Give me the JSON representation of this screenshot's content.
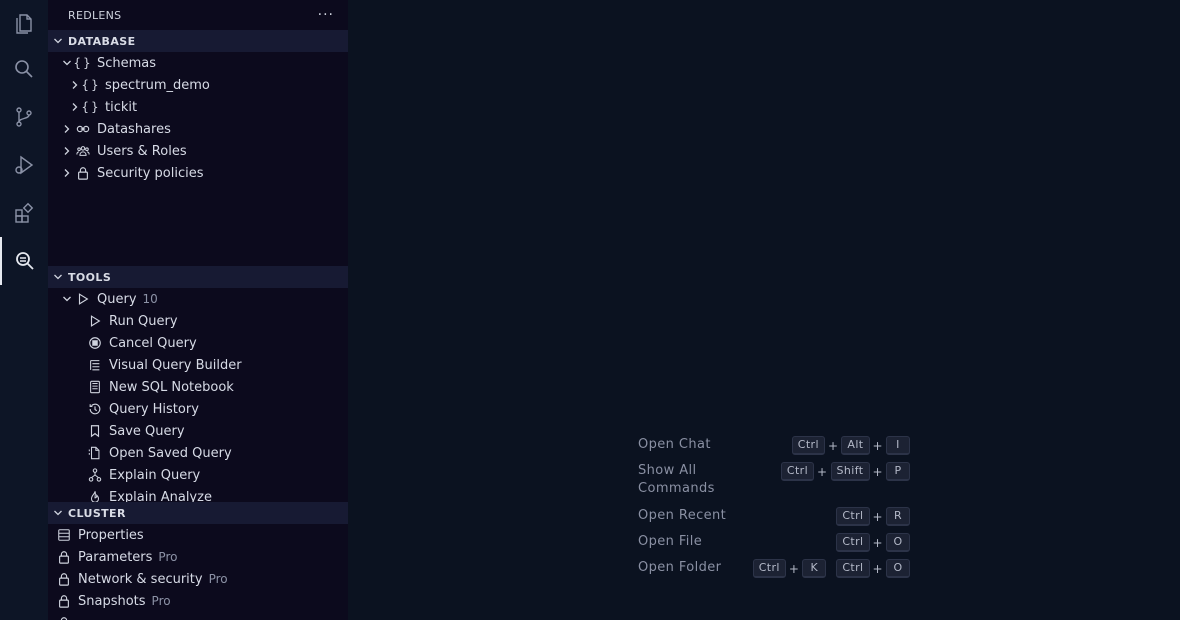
{
  "sidebar": {
    "title": "REDLENS",
    "more_label": "···",
    "database": {
      "title": "DATABASE",
      "schemas_label": "Schemas",
      "schema_items": [
        "spectrum_demo",
        "tickit"
      ],
      "datashares_label": "Datashares",
      "users_roles_label": "Users & Roles",
      "security_policies_label": "Security policies"
    },
    "tools": {
      "title": "TOOLS",
      "query_label": "Query",
      "query_count": "10",
      "items": [
        "Run Query",
        "Cancel Query",
        "Visual Query Builder",
        "New SQL Notebook",
        "Query History",
        "Save Query",
        "Open Saved Query",
        "Explain Query",
        "Explain Analyze"
      ]
    },
    "cluster": {
      "title": "CLUSTER",
      "properties_label": "Properties",
      "parameters_label": "Parameters",
      "parameters_badge": "Pro",
      "network_label": "Network & security",
      "network_badge": "Pro",
      "snapshots_label": "Snapshots",
      "snapshots_badge": "Pro"
    }
  },
  "shortcuts": [
    {
      "label": "Open Chat",
      "keys": [
        "Ctrl",
        "Alt",
        "I"
      ]
    },
    {
      "label": "Show All Commands",
      "keys": [
        "Ctrl",
        "Shift",
        "P"
      ]
    },
    {
      "label": "Open Recent",
      "keys": [
        "Ctrl",
        "R"
      ]
    },
    {
      "label": "Open File",
      "keys": [
        "Ctrl",
        "O"
      ]
    },
    {
      "label": "Open Folder",
      "keys": [
        "Ctrl",
        "K"
      ],
      "keys2": [
        "Ctrl",
        "O"
      ]
    }
  ],
  "colors": {
    "background": "#0b1220",
    "sidebar": "#0c0a1d",
    "section_header": "#171a33"
  }
}
